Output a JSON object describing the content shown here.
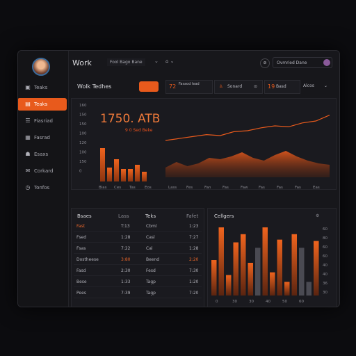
{
  "app": {
    "title": "Work",
    "breadcrumb": "Fool Bago Bane",
    "user_name": "Ovmried Dane"
  },
  "sidebar": {
    "items": [
      {
        "label": "Teaks",
        "icon": "image-icon",
        "active": false
      },
      {
        "label": "Teaks",
        "icon": "folder-icon",
        "active": true
      },
      {
        "label": "Fiasriad",
        "icon": "list-icon",
        "active": false
      },
      {
        "label": "Fasrad",
        "icon": "grid-icon",
        "active": false
      },
      {
        "label": "Esaxs",
        "icon": "people-icon",
        "active": false
      },
      {
        "label": "Corkard",
        "icon": "chat-icon",
        "active": false
      },
      {
        "label": "Tonfos",
        "icon": "clock-icon",
        "active": false
      }
    ]
  },
  "header": {
    "section_title": "Wolk Tedhes",
    "stat1_value": "72",
    "stat1_label": "Fasaod lead",
    "stat2_label": "Sonard",
    "stat3_value": "19",
    "stat3_label": "Basd",
    "stat4_label": "Alcos"
  },
  "kpi": {
    "value": "1750.",
    "unit": "ATB",
    "sub": "9 0 Sed Beke"
  },
  "top_chart": {
    "y_ticks": [
      "160",
      "150",
      "150",
      "100",
      "120",
      "100",
      "150",
      "0"
    ],
    "x_labels": [
      "Blas",
      "Ces",
      "Tas",
      "Eos"
    ],
    "bars": [
      48,
      20,
      32,
      18,
      18,
      24,
      14
    ],
    "line_x_labels": [
      "Lass",
      "Fes",
      "Fan",
      "Fas",
      "Faw",
      "Fas",
      "Fas",
      "Fas",
      "Eas"
    ],
    "line_values": [
      30,
      34,
      38,
      42,
      40,
      48,
      50,
      56,
      60,
      58,
      66,
      70,
      82
    ],
    "area_values": [
      14,
      22,
      16,
      20,
      28,
      26,
      30,
      36,
      28,
      24,
      32,
      38,
      30,
      24,
      20,
      18
    ]
  },
  "tables": {
    "left": {
      "headers": [
        "Bsaes",
        "Lass",
        "Teks",
        "Fafet"
      ],
      "rows": [
        {
          "a": "Fast",
          "b": "T:13",
          "c": "Cbml",
          "d": "1:23"
        },
        {
          "a": "Fsed",
          "b": "1:28",
          "c": "Casl",
          "d": "7:27"
        },
        {
          "a": "Fsas",
          "b": "7:22",
          "c": "Cal",
          "d": "1:28"
        },
        {
          "a": "Dostheese",
          "b": "3:80",
          "c": "Beend",
          "d": "2:20"
        },
        {
          "a": "Fasd",
          "b": "2:30",
          "c": "Fesd",
          "d": "7:30"
        },
        {
          "a": "Bese",
          "b": "1:33",
          "c": "Tagp",
          "d": "1:20"
        },
        {
          "a": "Pees",
          "b": "7:39",
          "c": "Tagp",
          "d": "7:20"
        }
      ]
    }
  },
  "bottom_chart": {
    "title": "Cellgers",
    "y_ticks": [
      "60",
      "80",
      "60",
      "60",
      "40",
      "40",
      "36",
      "30"
    ],
    "x_labels": [
      "0",
      "30",
      "30",
      "40",
      "50",
      "60"
    ],
    "bars": [
      52,
      100,
      30,
      78,
      90,
      48,
      70,
      100,
      34,
      82,
      20,
      90,
      70,
      20,
      80
    ]
  },
  "colors": {
    "accent": "#e85a1c",
    "bg": "#17171b"
  }
}
